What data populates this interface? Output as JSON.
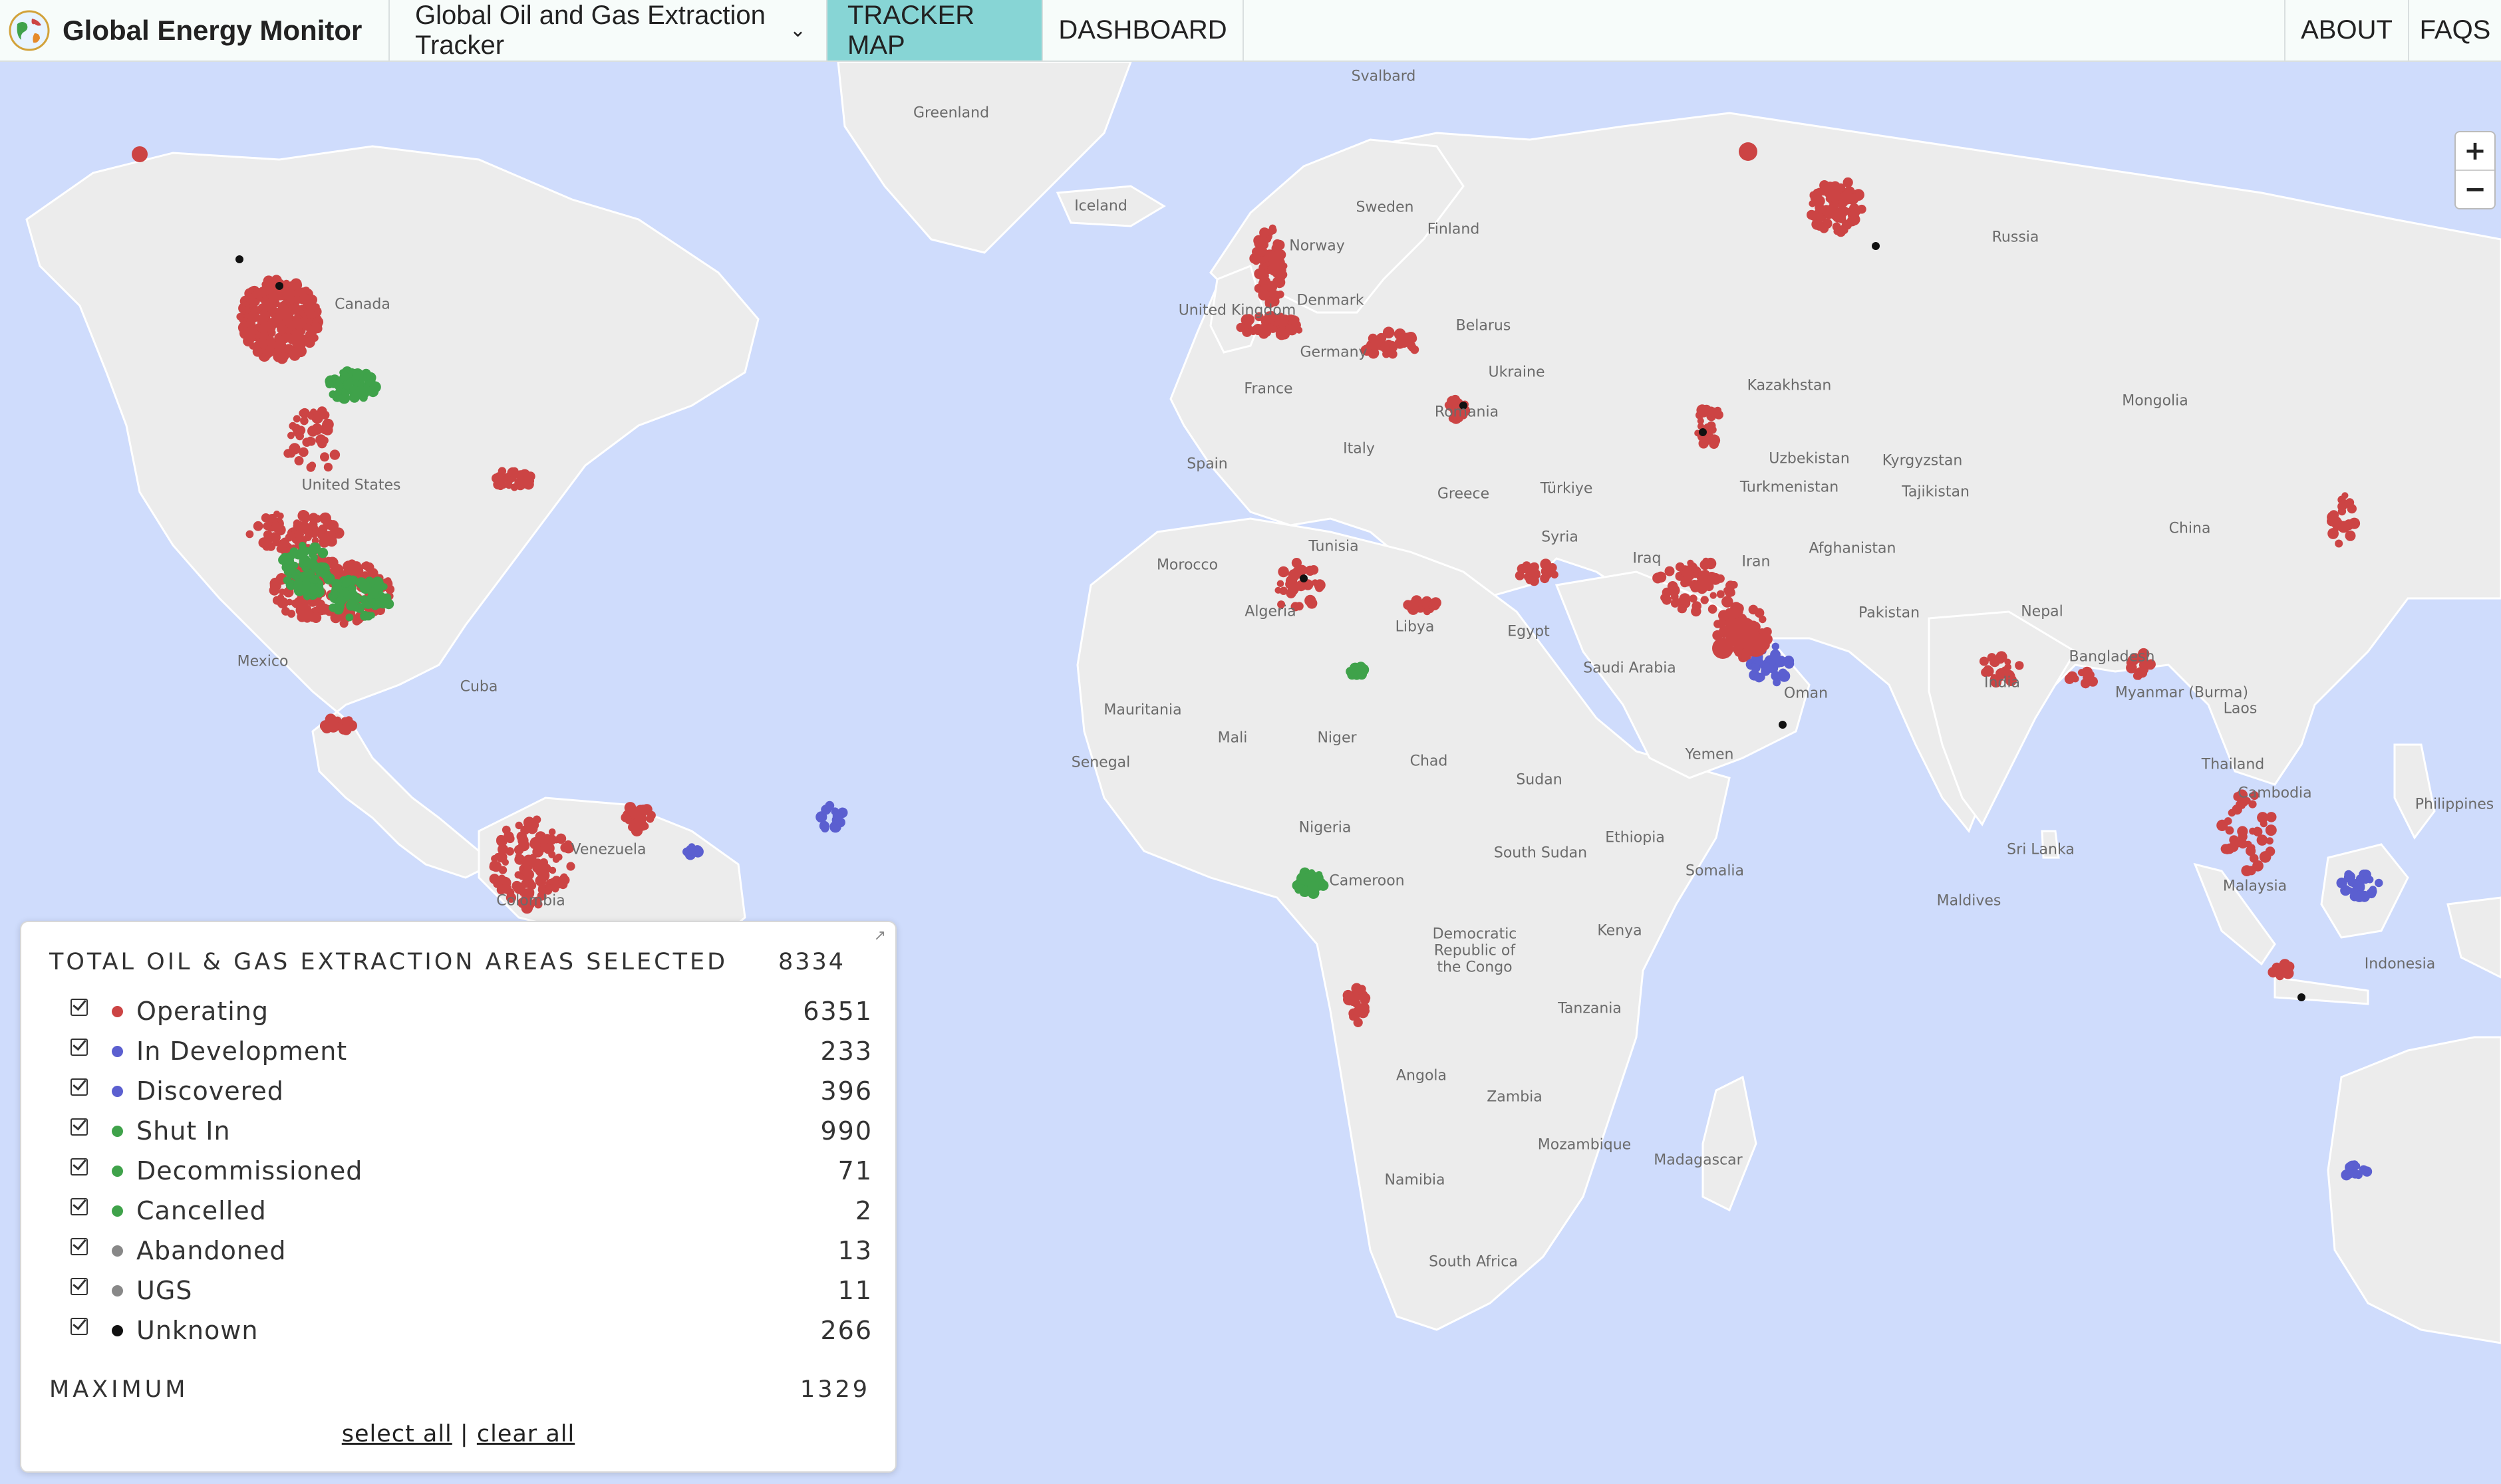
{
  "header": {
    "brand": "Global Energy Monitor",
    "tracker_label": "Global Oil and Gas Extraction Tracker",
    "tabs": [
      "TRACKER MAP",
      "DASHBOARD"
    ],
    "right_links": [
      "ABOUT",
      "FAQS"
    ]
  },
  "map": {
    "labels": [
      "Svalbard",
      "Greenland",
      "Iceland",
      "Sweden",
      "Finland",
      "Norway",
      "Russia",
      "Canada",
      "Denmark",
      "United Kingdom",
      "Germany",
      "Belarus",
      "Ukraine",
      "France",
      "Romania",
      "Kazakhstan",
      "Mongolia",
      "United States",
      "Spain",
      "Italy",
      "Uzbekistan",
      "Kyrgyzstan",
      "Turkmenistan",
      "Tajikistan",
      "Türkiye",
      "Greece",
      "China",
      "Syria",
      "Iraq",
      "Iran",
      "Afghanistan",
      "Morocco",
      "Tunisia",
      "Algeria",
      "Libya",
      "Egypt",
      "Pakistan",
      "Nepal",
      "Mexico",
      "Cuba",
      "Saudi Arabia",
      "Bangladesh",
      "India",
      "Myanmar (Burma)",
      "Laos",
      "Mauritania",
      "Mali",
      "Niger",
      "Chad",
      "Sudan",
      "Yemen",
      "Oman",
      "Thailand",
      "Senegal",
      "Cambodia",
      "Philippines",
      "Nigeria",
      "Ethiopia",
      "South Sudan",
      "Somalia",
      "Venezuela",
      "Colombia",
      "Cameroon",
      "Sri Lanka",
      "Malaysia",
      "Maldives",
      "Democratic Republic of the Congo",
      "Kenya",
      "Indonesia",
      "Tanzania",
      "Angola",
      "Zambia",
      "Mozambique",
      "Madagascar",
      "Namibia",
      "South Africa"
    ],
    "zoom_in": "+",
    "zoom_out": "−"
  },
  "legend": {
    "title": "TOTAL OIL & GAS EXTRACTION AREAS SELECTED",
    "total": "8334",
    "items": [
      {
        "label": "Operating",
        "count": "6351",
        "color": "#cc4444"
      },
      {
        "label": "In Development",
        "count": "233",
        "color": "#5b5fd0"
      },
      {
        "label": "Discovered",
        "count": "396",
        "color": "#5b5fd0"
      },
      {
        "label": "Shut In",
        "count": "990",
        "color": "#3fa24a"
      },
      {
        "label": "Decommissioned",
        "count": "71",
        "color": "#3fa24a"
      },
      {
        "label": "Cancelled",
        "count": "2",
        "color": "#3fa24a"
      },
      {
        "label": "Abandoned",
        "count": "13",
        "color": "#888888"
      },
      {
        "label": "UGS",
        "count": "11",
        "color": "#888888"
      },
      {
        "label": "Unknown",
        "count": "266",
        "color": "#111111"
      }
    ],
    "maximum_label": "MAXIMUM",
    "maximum_value": "1329",
    "select_all": "select all",
    "separator": "|",
    "clear_all": "clear all"
  }
}
